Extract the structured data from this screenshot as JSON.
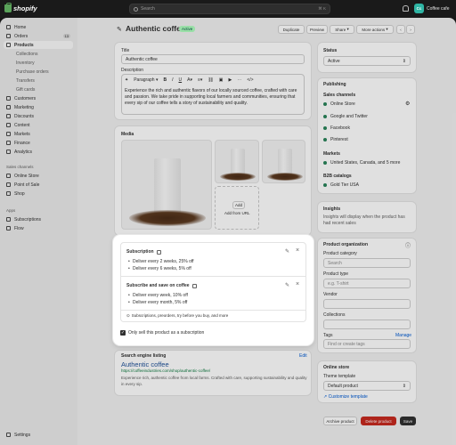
{
  "topbar": {
    "logo_text": "shopify",
    "search_placeholder": "Search",
    "search_shortcut": "⌘ K",
    "store_initials": "Cc",
    "store_name": "Coffee cafe"
  },
  "sidebar": {
    "items": [
      {
        "label": "Home"
      },
      {
        "label": "Orders",
        "badge": "13"
      },
      {
        "label": "Products"
      },
      {
        "label": "Collections"
      },
      {
        "label": "Inventory"
      },
      {
        "label": "Purchase orders"
      },
      {
        "label": "Transfers"
      },
      {
        "label": "Gift cards"
      },
      {
        "label": "Customers"
      },
      {
        "label": "Marketing"
      },
      {
        "label": "Discounts"
      },
      {
        "label": "Content"
      },
      {
        "label": "Markets"
      },
      {
        "label": "Finance"
      },
      {
        "label": "Analytics"
      }
    ],
    "sales_channels_heading": "Sales channels",
    "sales_channels": [
      {
        "label": "Online Store"
      },
      {
        "label": "Point of Sale"
      },
      {
        "label": "Shop"
      }
    ],
    "apps_heading": "Apps",
    "apps": [
      {
        "label": "Subscriptions"
      },
      {
        "label": "Flow"
      }
    ],
    "settings_label": "Settings"
  },
  "header": {
    "title": "Authentic coffee",
    "status": "Active",
    "duplicate": "Duplicate",
    "preview": "Preview",
    "share": "Share",
    "more_actions": "More actions"
  },
  "product": {
    "title_label": "Title",
    "title_value": "Authentic coffee",
    "description_label": "Description",
    "paragraph_select": "Paragraph",
    "description": "Experience the rich and authentic flavors of our locally sourced coffee, crafted with care and passion. We take pride in supporting local farmers and communities, ensuring that every sip of our coffee tells a story of sustainability and quality.",
    "media_label": "Media",
    "add_button": "Add",
    "add_from_url": "Add from URL"
  },
  "subscriptions": {
    "plans": [
      {
        "title": "Subscription",
        "items": [
          "Deliver every 2 weeks, 25% off",
          "Deliver every 6 weeks, 5% off"
        ]
      },
      {
        "title": "Subscribe and save on coffee",
        "items": [
          "Deliver every week, 10% off",
          "Deliver every month, 5% off"
        ]
      }
    ],
    "footer_text": "Subscriptions, preorders, try before you buy, and more",
    "only_subscription_label": "Only sell this product as a subscription"
  },
  "seo": {
    "heading": "Search engine listing",
    "edit": "Edit",
    "title": "Authentic coffee",
    "url": "https://coffeeindustries.com/shop/authentic-coffee/",
    "description": "Experience rich, authentic coffee from local farms. Crafted with care, supporting sustainability and quality in every sip."
  },
  "status_card": {
    "label": "Status",
    "value": "Active"
  },
  "publishing": {
    "heading": "Publishing",
    "channels_heading": "Sales channels",
    "channels": [
      "Online Store",
      "Google and Twitter",
      "Facebook",
      "Pinterest"
    ],
    "markets_heading": "Markets",
    "markets_value": "United States, Canada, and 5 more",
    "b2b_heading": "B2B catalogs",
    "b2b_value": "Gold Tier USA"
  },
  "insights": {
    "heading": "Insights",
    "text": "Insights will display when the product has had recent sales"
  },
  "organization": {
    "heading": "Product organization",
    "category_label": "Product category",
    "category_placeholder": "Search",
    "type_label": "Product type",
    "type_placeholder": "e.g. T-shirt",
    "vendor_label": "Vendor",
    "collections_label": "Collections",
    "tags_label": "Tags",
    "tags_manage": "Manage",
    "tags_placeholder": "Find or create tags"
  },
  "online_store": {
    "heading": "Online store",
    "theme_label": "Theme template",
    "theme_value": "Default product",
    "customize": "Customize template"
  },
  "footer": {
    "archive": "Archive product",
    "delete": "Delete product",
    "save": "Save"
  }
}
